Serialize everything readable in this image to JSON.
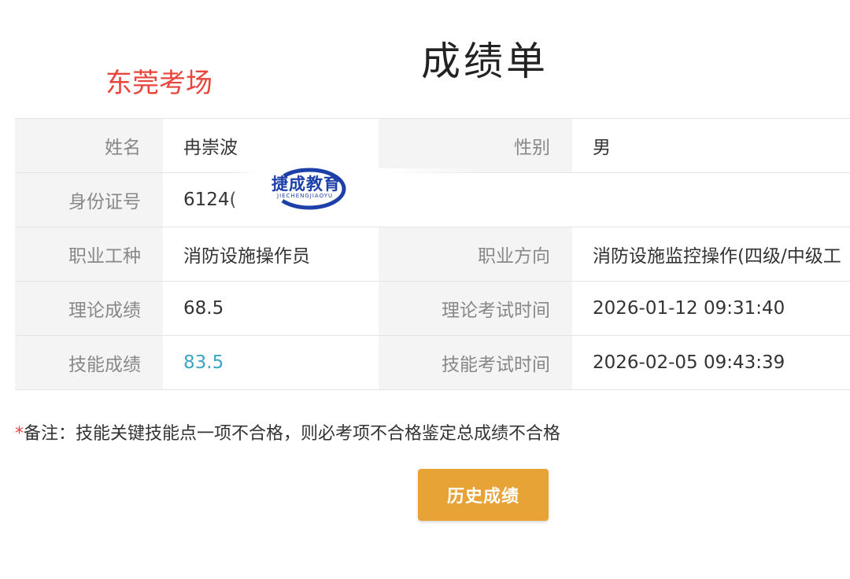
{
  "page": {
    "title": "成绩单",
    "stamp": "东莞考场"
  },
  "rows": [
    {
      "l1": "姓名",
      "v1": "冉崇波",
      "l2": "性别",
      "v2": "男"
    },
    {
      "l1": "身份证号",
      "v1": "6124("
    },
    {
      "l1": "职业工种",
      "v1": "消防设施操作员",
      "l2": "职业方向",
      "v2": "消防设施监控操作(四级/中级工"
    },
    {
      "l1": "理论成绩",
      "v1": "68.5",
      "l2": "理论考试时间",
      "v2": "2026-01-12 09:31:40"
    },
    {
      "l1": "技能成绩",
      "v1": "83.5",
      "l2": "技能考试时间",
      "v2": "2026-02-05 09:43:39"
    }
  ],
  "logo": {
    "text": "捷成教育",
    "sub": "JIECHENGJIAOYU"
  },
  "note": {
    "star": "*",
    "text": "备注：技能关键技能点一项不合格，则必考项不合格鉴定总成绩不合格"
  },
  "button": {
    "label": "历史成绩"
  },
  "colors": {
    "accent": "#e8a336",
    "stamp": "#e8453c",
    "score": "#3aa6c4"
  }
}
